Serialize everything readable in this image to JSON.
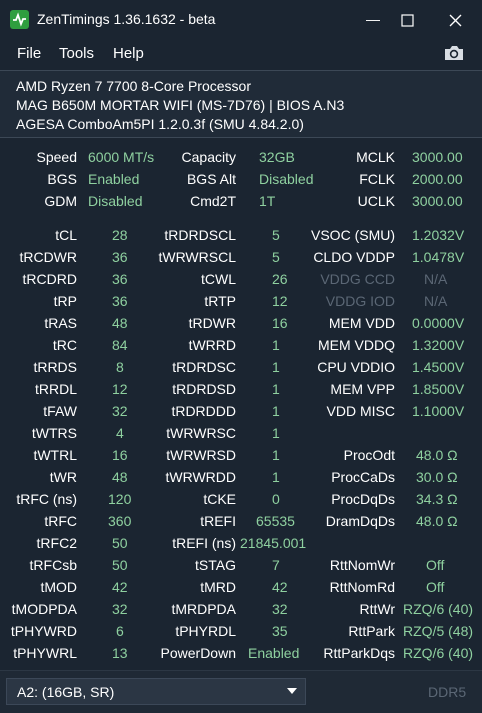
{
  "window": {
    "title": "ZenTimings 1.36.1632 - beta",
    "minimize": "—",
    "maximize": "☐",
    "close": "✕"
  },
  "menu": [
    "File",
    "Tools",
    "Help"
  ],
  "icons": {
    "app": "zentimings-logo-icon",
    "screenshot": "camera-icon"
  },
  "system": {
    "cpu": "AMD Ryzen 7 7700 8-Core Processor",
    "board": "MAG B650M MORTAR WIFI (MS-7D76) | BIOS A.N3",
    "agesa": "AGESA ComboAm5PI 1.2.0.3f (SMU 4.84.2.0)"
  },
  "top": {
    "col1": [
      [
        "Speed",
        "6000 MT/s"
      ],
      [
        "BGS",
        "Enabled"
      ],
      [
        "GDM",
        "Disabled"
      ]
    ],
    "col2": [
      [
        "Capacity",
        "32GB"
      ],
      [
        "BGS Alt",
        "Disabled"
      ],
      [
        "Cmd2T",
        "1T"
      ]
    ],
    "col3": [
      [
        "MCLK",
        "3000.00"
      ],
      [
        "FCLK",
        "2000.00"
      ],
      [
        "UCLK",
        "3000.00"
      ]
    ]
  },
  "timings": {
    "col1": [
      [
        "tCL",
        "28"
      ],
      [
        "tRCDWR",
        "36"
      ],
      [
        "tRCDRD",
        "36"
      ],
      [
        "tRP",
        "36"
      ],
      [
        "tRAS",
        "48"
      ],
      [
        "tRC",
        "84"
      ],
      [
        "tRRDS",
        "8"
      ],
      [
        "tRRDL",
        "12"
      ],
      [
        "tFAW",
        "32"
      ],
      [
        "tWTRS",
        "4"
      ],
      [
        "tWTRL",
        "16"
      ],
      [
        "tWR",
        "48"
      ],
      [
        "tRFC (ns)",
        "120"
      ],
      [
        "tRFC",
        "360"
      ],
      [
        "tRFC2",
        "50"
      ],
      [
        "tRFCsb",
        "50"
      ],
      [
        "tMOD",
        "42"
      ],
      [
        "tMODPDA",
        "32"
      ],
      [
        "tPHYWRD",
        "6"
      ],
      [
        "tPHYWRL",
        "13"
      ]
    ],
    "col2": [
      [
        "tRDRDSCL",
        "5"
      ],
      [
        "tWRWRSCL",
        "5"
      ],
      [
        "tCWL",
        "26"
      ],
      [
        "tRTP",
        "12"
      ],
      [
        "tRDWR",
        "16"
      ],
      [
        "tWRRD",
        "1"
      ],
      [
        "tRDRDSC",
        "1"
      ],
      [
        "tRDRDSD",
        "1"
      ],
      [
        "tRDRDDD",
        "1"
      ],
      [
        "tWRWRSC",
        "1"
      ],
      [
        "tWRWRSD",
        "1"
      ],
      [
        "tWRWRDD",
        "1"
      ],
      [
        "tCKE",
        "0"
      ],
      [
        "tREFI",
        "65535"
      ],
      [
        "tREFI (ns)",
        "21845.001"
      ],
      [
        "tSTAG",
        "7"
      ],
      [
        "tMRD",
        "42"
      ],
      [
        "tMRDPDA",
        "32"
      ],
      [
        "tPHYRDL",
        "35"
      ],
      [
        "PowerDown",
        "Enabled"
      ]
    ],
    "col3": [
      [
        "VSOC (SMU)",
        "1.2032V"
      ],
      [
        "CLDO VDDP",
        "1.0478V"
      ],
      [
        "VDDG CCD",
        "N/A"
      ],
      [
        "VDDG IOD",
        "N/A"
      ],
      [
        "MEM VDD",
        "0.0000V"
      ],
      [
        "MEM VDDQ",
        "1.3200V"
      ],
      [
        "CPU VDDIO",
        "1.4500V"
      ],
      [
        "MEM VPP",
        "1.8500V"
      ],
      [
        "VDD MISC",
        "1.1000V"
      ],
      [
        "",
        ""
      ],
      [
        "ProcOdt",
        "48.0 Ω"
      ],
      [
        "ProcCaDs",
        "30.0 Ω"
      ],
      [
        "ProcDqDs",
        "34.3 Ω"
      ],
      [
        "DramDqDs",
        "48.0 Ω"
      ],
      [
        "",
        ""
      ],
      [
        "RttNomWr",
        "Off"
      ],
      [
        "RttNomRd",
        "Off"
      ],
      [
        "RttWr",
        "RZQ/6 (40)"
      ],
      [
        "RttPark",
        "RZQ/5 (48)"
      ],
      [
        "RttParkDqs",
        "RZQ/6 (40)"
      ]
    ],
    "col3_dimmed": [
      "VDDG CCD",
      "VDDG IOD"
    ]
  },
  "footer": {
    "dimm_select": "A2:  (16GB, SR)",
    "memory_type": "DDR5"
  },
  "colors": {
    "background": "#1b2531",
    "value_green": "#8fd1a0",
    "dimmed": "#5b6775",
    "logo": "#2f9e3f"
  }
}
